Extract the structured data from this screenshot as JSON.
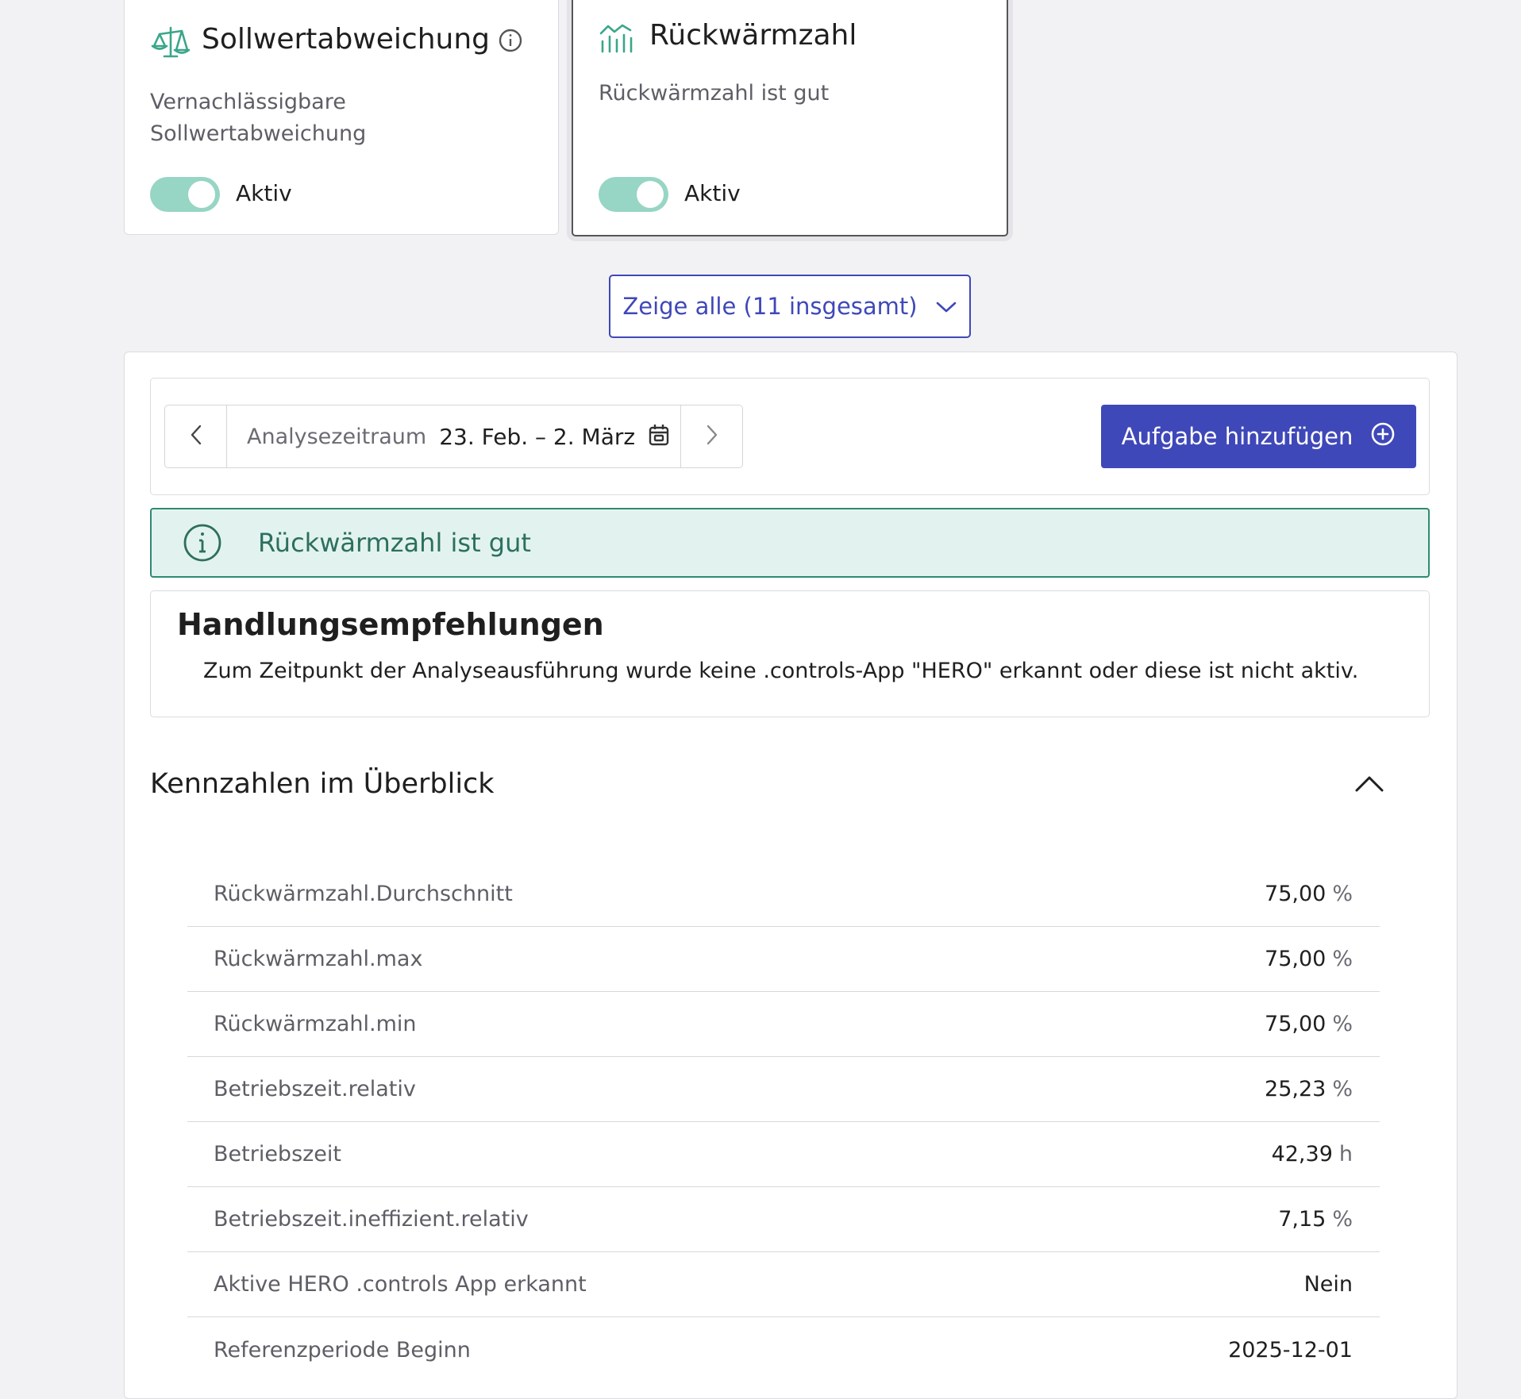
{
  "cards": [
    {
      "title": "Sollwertabweichung",
      "desc_line1": "Vernachlässigbare",
      "desc_line2": "Sollwertabweichung",
      "toggle_label": "Aktiv",
      "icon": "scale-icon"
    },
    {
      "title": "Rückwärmzahl",
      "desc_line1": "Rückwärmzahl ist gut",
      "toggle_label": "Aktiv",
      "icon": "chart-icon"
    }
  ],
  "show_all_label": "Zeige alle (11 insgesamt)",
  "toolbar": {
    "period_label": "Analysezeitraum",
    "period_value": "23. Feb. – 2. März",
    "add_task_label": "Aufgabe hinzufügen"
  },
  "alert": {
    "text": "Rückwärmzahl ist gut"
  },
  "recommend": {
    "title": "Handlungsempfehlungen",
    "text": "Zum Zeitpunkt der Analyseausführung wurde keine .controls-App \"HERO\" erkannt oder diese ist nicht aktiv."
  },
  "kpi": {
    "title": "Kennzahlen im Überblick",
    "rows": [
      {
        "name": "Rückwärmzahl.Durchschnitt",
        "value": "75,00",
        "unit": "%"
      },
      {
        "name": "Rückwärmzahl.max",
        "value": "75,00",
        "unit": "%"
      },
      {
        "name": "Rückwärmzahl.min",
        "value": "75,00",
        "unit": "%"
      },
      {
        "name": "Betriebszeit.relativ",
        "value": "25,23",
        "unit": "%"
      },
      {
        "name": "Betriebszeit",
        "value": "42,39",
        "unit": "h"
      },
      {
        "name": "Betriebszeit.ineffizient.relativ",
        "value": "7,15",
        "unit": "%"
      },
      {
        "name": "Aktive HERO .controls App erkannt",
        "value": "Nein",
        "unit": ""
      },
      {
        "name": "Referenzperiode Beginn",
        "value": "2025-12-01",
        "unit": ""
      }
    ]
  },
  "colors": {
    "accent": "#3f48b8",
    "teal": "#97d5c4",
    "alert_bg": "#e2f3ef",
    "alert_border": "#2f8a72"
  }
}
